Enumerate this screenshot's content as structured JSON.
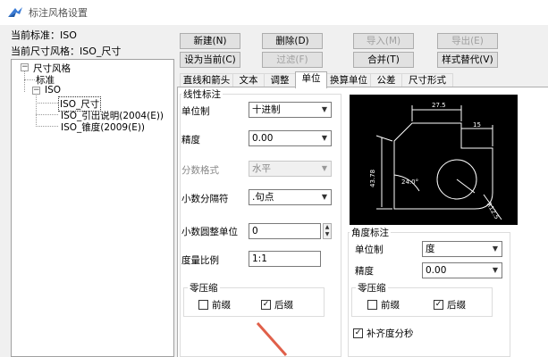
{
  "window": {
    "title": "标注风格设置"
  },
  "info": {
    "current_standard": "当前标准：ISO",
    "current_style": "当前尺寸风格：ISO_尺寸"
  },
  "tree": {
    "root": "尺寸风格",
    "items": [
      "标准",
      "ISO",
      "ISO_尺寸",
      "ISO_引出说明(2004(E))",
      "ISO_锥度(2009(E))"
    ]
  },
  "buttons": {
    "new": "新建(N)",
    "delete": "删除(D)",
    "import": "导入(M)",
    "export": "导出(E)",
    "set_current": "设为当前(C)",
    "filter": "过滤(F)",
    "merge": "合并(T)",
    "style_override": "样式替代(V)"
  },
  "tabs": [
    "直线和箭头",
    "文本",
    "调整",
    "单位",
    "换算单位",
    "公差",
    "尺寸形式"
  ],
  "linear": {
    "group_title": "线性标注",
    "unit_label": "单位制",
    "unit_value": "十进制",
    "precision_label": "精度",
    "precision_value": "0.00",
    "fraction_label": "分数格式",
    "fraction_value": "水平",
    "decimal_sep_label": "小数分隔符",
    "decimal_sep_value": ".句点",
    "round_label": "小数圆整单位",
    "round_value": "0",
    "scale_label": "度量比例",
    "scale_value": "1:1",
    "zero_title": "零压缩",
    "leading": "前缀",
    "trailing": "后缀"
  },
  "angular": {
    "group_title": "角度标注",
    "unit_label": "单位制",
    "unit_value": "度",
    "precision_label": "精度",
    "precision_value": "0.00",
    "zero_title": "零压缩",
    "leading": "前缀",
    "trailing": "后缀",
    "fill_seconds": "补齐度分秒"
  },
  "preview": {
    "dim_top": "27.5",
    "dim_small": "15",
    "dim_left": "43.78",
    "dim_angle": "24.0°",
    "dim_right": "R12.5"
  },
  "colors": {
    "accent_arrow": "#e0604a"
  }
}
